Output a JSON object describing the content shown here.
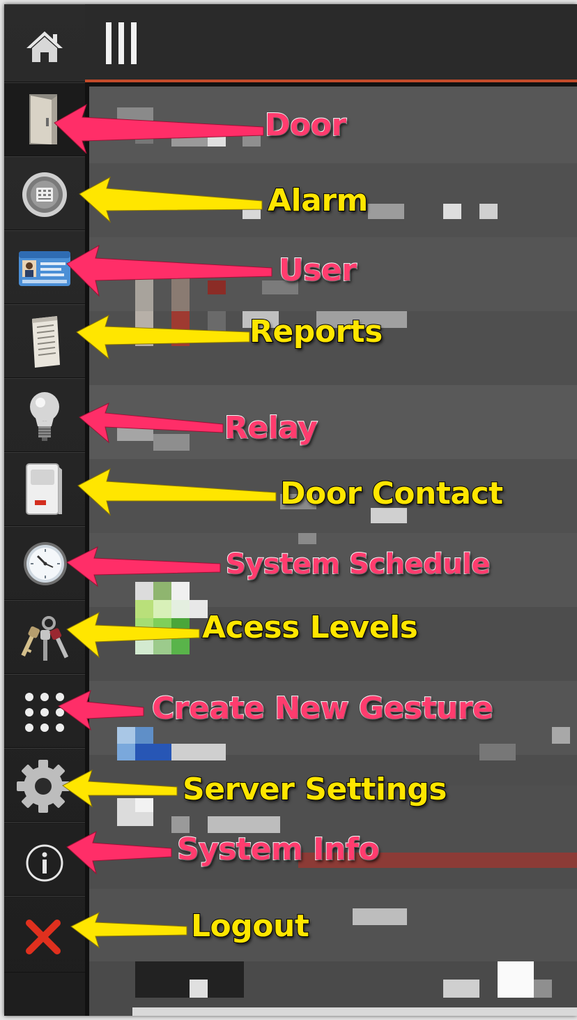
{
  "annotations": [
    {
      "key": "door",
      "label": "Door",
      "color": "pink"
    },
    {
      "key": "alarm",
      "label": "Alarm",
      "color": "yellow"
    },
    {
      "key": "user",
      "label": "User",
      "color": "pink"
    },
    {
      "key": "reports",
      "label": "Reports",
      "color": "yellow"
    },
    {
      "key": "relay",
      "label": "Relay",
      "color": "pink"
    },
    {
      "key": "door_contact",
      "label": "Door Contact",
      "color": "yellow"
    },
    {
      "key": "system_schedule",
      "label": "System Schedule",
      "color": "pink"
    },
    {
      "key": "access_levels",
      "label": "Acess Levels",
      "color": "yellow"
    },
    {
      "key": "create_gesture",
      "label": "Create New Gesture",
      "color": "pink"
    },
    {
      "key": "server_settings",
      "label": "Server Settings",
      "color": "yellow"
    },
    {
      "key": "system_info",
      "label": "System Info",
      "color": "pink"
    },
    {
      "key": "logout",
      "label": "Logout",
      "color": "yellow"
    }
  ],
  "sidebar_icons": [
    "home-icon",
    "door-icon",
    "alarm-keypad-icon",
    "user-id-card-icon",
    "reports-icon",
    "light-bulb-icon",
    "motion-sensor-icon",
    "clock-icon",
    "keys-icon",
    "gesture-grid-icon",
    "gear-icon",
    "info-icon",
    "close-icon"
  ],
  "colors": {
    "pink": "#ff3c6e",
    "yellow": "#ffe600",
    "accent_bar": "#c34b2a",
    "logout_x": "#e0301e"
  }
}
